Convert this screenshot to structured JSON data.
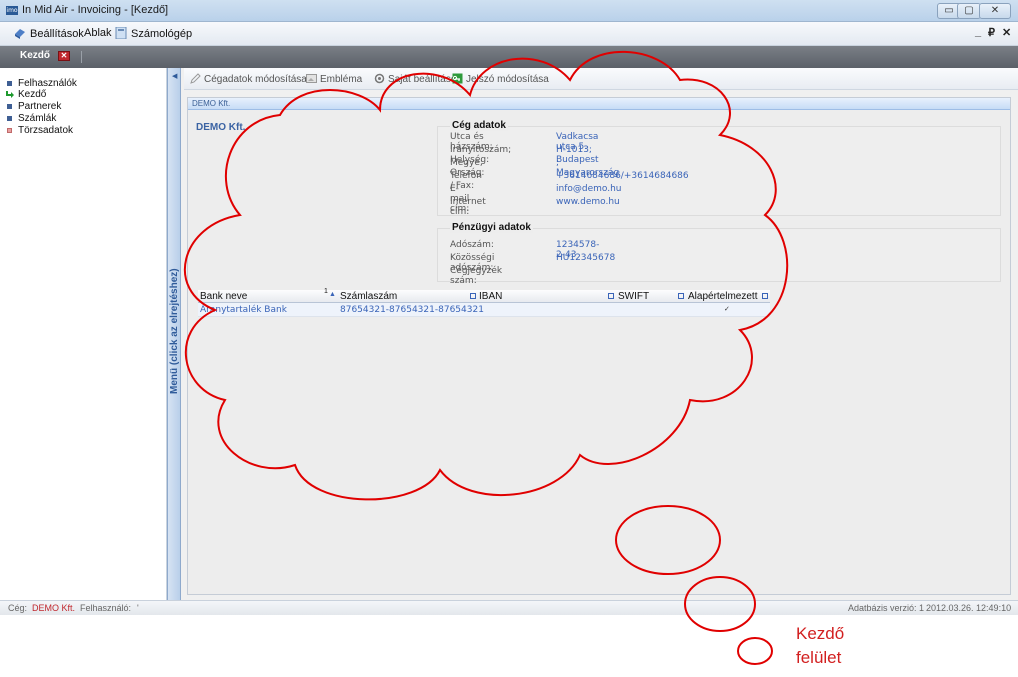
{
  "window": {
    "title": "In Mid Air - Invoicing - [Kezdő]",
    "minimize": "▭",
    "maximize": "▢",
    "close": "✕"
  },
  "menu": {
    "items": [
      "Beállítások",
      "Ablak",
      "Számológép"
    ],
    "mdi_controls": [
      "_",
      "₽",
      "✕"
    ]
  },
  "tabs": {
    "active": "Kezdő",
    "close": "✕"
  },
  "sidebar": {
    "items": [
      "Felhasználók",
      "Kezdő",
      "Partnerek",
      "Számlák",
      "Törzsadatok"
    ]
  },
  "collapse_panel": {
    "label": "Menü (click az elrejtéshez)"
  },
  "toolbar": {
    "items": [
      "Cégadatok módosítása",
      "Embléma",
      "Saját beállítások",
      "Jelszó módosítása"
    ]
  },
  "panel": {
    "header": "DEMO Kft.",
    "company_name": "DEMO Kft."
  },
  "company_group": {
    "title": "Cég adatok",
    "rows": [
      {
        "label": "Utca és házszám:",
        "value": "Vadkacsa utca 5."
      },
      {
        "label": "Irányítószám; Helység:",
        "value": "H-1013; Budapest"
      },
      {
        "label": "Megye; Ország:",
        "value": "; Magyarország"
      },
      {
        "label": "Telefon / Fax:",
        "value": "+3614684686/+3614684686"
      },
      {
        "label": "E-mail cím:",
        "value": "info@demo.hu"
      },
      {
        "label": "Internet cím:",
        "value": "www.demo.hu"
      }
    ]
  },
  "finance_group": {
    "title": "Pénzügyi adatok",
    "rows": [
      {
        "label": "Adószám:",
        "value": "1234578-2-43"
      },
      {
        "label": "Közösségi adószám:",
        "value": "HU12345678"
      },
      {
        "label": "Cégjegyzék szám:",
        "value": ""
      }
    ]
  },
  "bank_grid": {
    "columns": [
      "Bank neve",
      "Számlaszám",
      "IBAN",
      "SWIFT",
      "Alapértelmezett"
    ],
    "sort_indicator": "1",
    "rows": [
      {
        "bank": "Aranytartalék Bank",
        "account": "87654321-87654321-87654321",
        "iban": "",
        "swift": "",
        "default": "✓"
      }
    ]
  },
  "status": {
    "company_label": "Cég:",
    "company_value": "DEMO Kft.",
    "user_label": "Felhasználó:",
    "user_value": "'",
    "db_version": "Adatbázis verzió: 1",
    "datetime": "2012.03.26. 12:49:10"
  },
  "annotation": {
    "line1": "Kezdő",
    "line2": "felület",
    "color": "#d21f1f"
  }
}
